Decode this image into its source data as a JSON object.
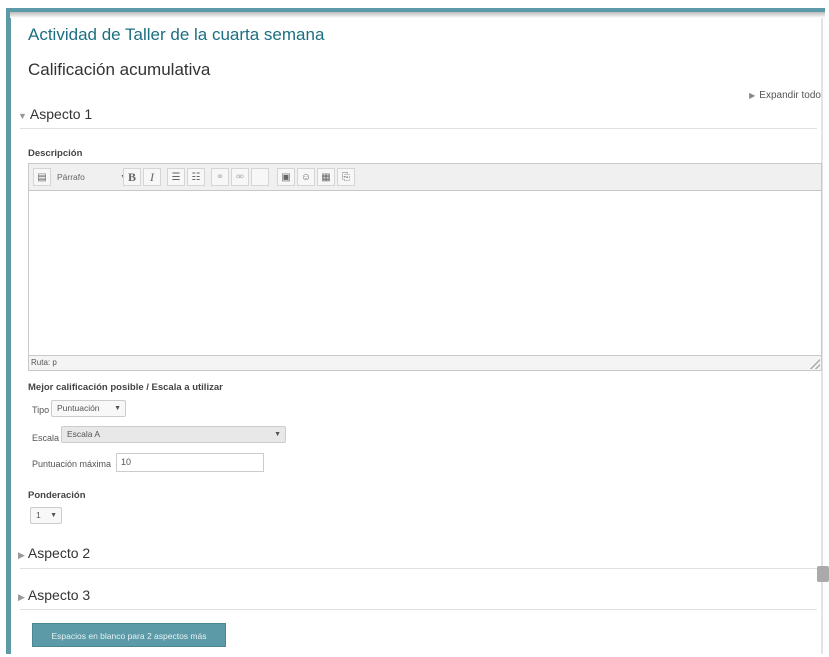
{
  "activity_title": "Actividad de Taller de la cuarta semana",
  "strategy_title": "Calificación acumulativa",
  "expand_all": "Expandir todo",
  "aspects": [
    {
      "label": "Aspecto 1",
      "expanded": true
    },
    {
      "label": "Aspecto 2",
      "expanded": false
    },
    {
      "label": "Aspecto 3",
      "expanded": false
    }
  ],
  "description": {
    "label": "Descripción",
    "format_selected": "Párrafo",
    "path_text": "Ruta: p",
    "toolbar_icons": [
      "toggle-toolbar-icon",
      "bold-icon",
      "italic-icon",
      "unordered-list-icon",
      "ordered-list-icon",
      "link-icon",
      "unlink-icon",
      "image-icon",
      "emoticon-icon",
      "media-icon",
      "manage-files-icon"
    ]
  },
  "grade": {
    "label": "Mejor calificación posible / Escala a utilizar",
    "type_label": "Tipo",
    "type_value": "Puntuación",
    "scale_label": "Escala",
    "scale_value": "Escala A",
    "max_label": "Puntuación máxima",
    "max_value": "10"
  },
  "weight": {
    "label": "Ponderación",
    "value": "1"
  },
  "add_blanks_button": "Espacios en blanco para 2 aspectos más",
  "colors": {
    "accent": "#5b9aa6",
    "title": "#1c6f82"
  }
}
